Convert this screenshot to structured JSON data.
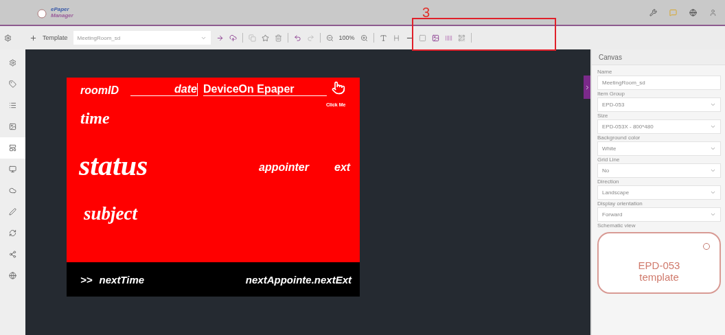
{
  "header": {
    "logo_top": "ePaper",
    "logo_bottom": "Manager",
    "annotation": "3"
  },
  "sidebar": {
    "items": [
      {
        "kind": "settings",
        "selected": false
      },
      {
        "kind": "tag",
        "selected": false
      },
      {
        "kind": "list",
        "selected": false
      },
      {
        "kind": "image",
        "selected": false
      },
      {
        "kind": "template",
        "selected": true
      },
      {
        "kind": "monitor",
        "selected": false
      },
      {
        "kind": "cloud",
        "selected": false
      },
      {
        "kind": "pen",
        "selected": false
      },
      {
        "kind": "refresh",
        "selected": false
      },
      {
        "kind": "share",
        "selected": false
      },
      {
        "kind": "globe",
        "selected": false
      }
    ]
  },
  "toolbar": {
    "template_label": "Template",
    "template": "MeetingRoom_sd",
    "zoom": "100%"
  },
  "canvas": {
    "elements": [
      {
        "kind": "label",
        "text": "roomID"
      },
      {
        "kind": "underlined",
        "text": "date"
      },
      {
        "kind": "title",
        "text": "DeviceOn Epaper"
      },
      {
        "kind": "hint",
        "text": "Click Me"
      },
      {
        "kind": "label",
        "text": "time"
      },
      {
        "kind": "label",
        "text": "status"
      },
      {
        "kind": "label",
        "text": "appointer"
      },
      {
        "kind": "label",
        "text": "ext"
      },
      {
        "kind": "label",
        "text": "subject"
      }
    ],
    "footer": [
      {
        "text": ">>"
      },
      {
        "text": "nextTime"
      },
      {
        "text": "nextAppointe.nextExt"
      }
    ]
  },
  "panel": {
    "title": "Canvas",
    "fields": [
      {
        "label": "Name",
        "value": "MeetingRoom_sd",
        "kind": "text"
      },
      {
        "label": "Item Group",
        "value": "EPD-053",
        "kind": "select"
      },
      {
        "label": "Size",
        "value": "EPD-053X - 800*480",
        "kind": "select"
      },
      {
        "label": "Background color",
        "value": "White",
        "kind": "select"
      },
      {
        "label": "Grid Line",
        "value": "No",
        "kind": "select"
      },
      {
        "label": "Direction",
        "value": "Landscape",
        "kind": "select"
      },
      {
        "label": "Display orientation",
        "value": "Forward",
        "kind": "select"
      }
    ],
    "preview_label": "Schematic view",
    "preview_text": "EPD-053 template"
  }
}
